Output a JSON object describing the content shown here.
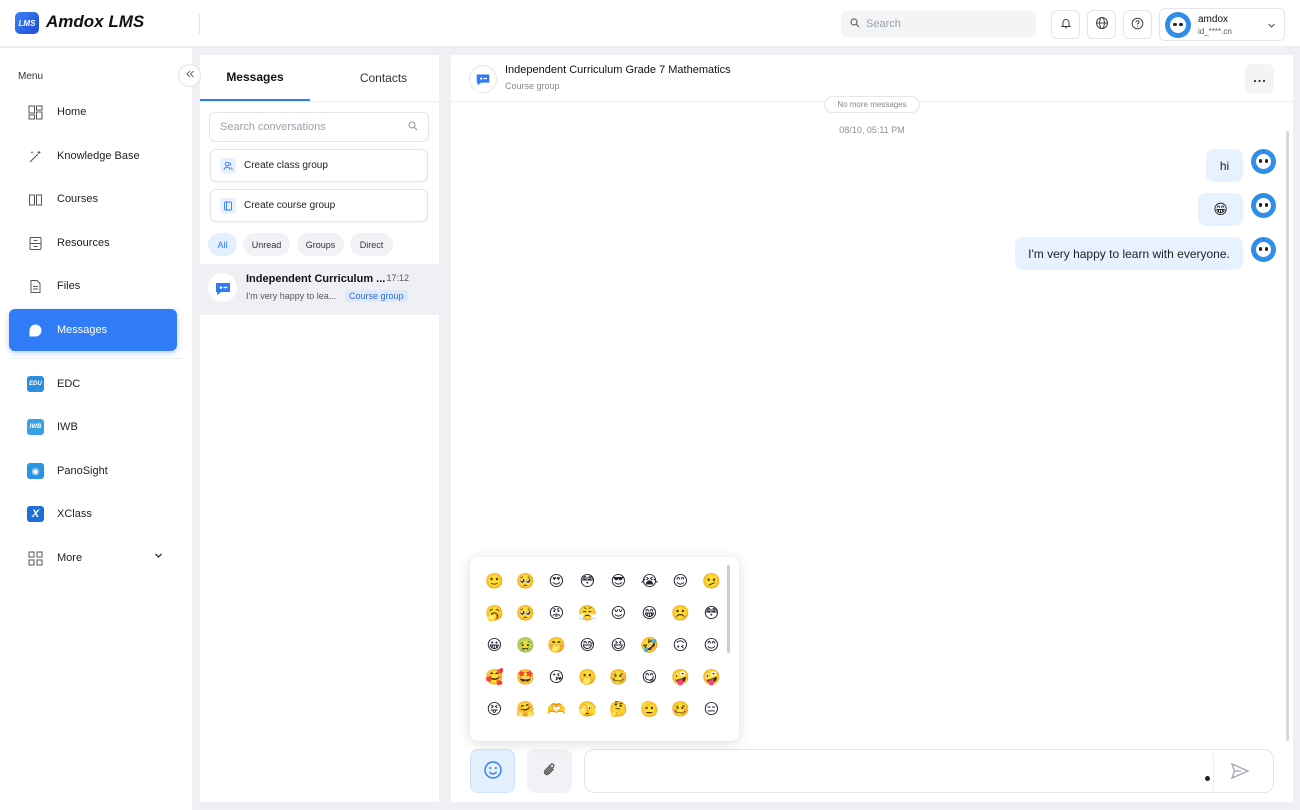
{
  "app": {
    "logo_text": "LMS",
    "title": "Amdox LMS"
  },
  "header": {
    "search_placeholder": "Search",
    "user": {
      "name": "amdox",
      "id": "id_****.cn"
    }
  },
  "sidebar": {
    "menu_label": "Menu",
    "items": [
      {
        "label": "Home",
        "icon": "home-icon"
      },
      {
        "label": "Knowledge Base",
        "icon": "wand-icon"
      },
      {
        "label": "Courses",
        "icon": "book-icon"
      },
      {
        "label": "Resources",
        "icon": "archive-icon"
      },
      {
        "label": "Files",
        "icon": "file-icon"
      },
      {
        "label": "Messages",
        "icon": "chat-icon",
        "active": true
      }
    ],
    "apps": [
      {
        "label": "EDC",
        "badge": "EDU",
        "color": "#2b8fe0"
      },
      {
        "label": "IWB",
        "badge": "IWB",
        "color": "#3aa0e6"
      },
      {
        "label": "PanoSight",
        "badge": "◉",
        "color": "#2596e8"
      },
      {
        "label": "XClass",
        "badge": "X",
        "color": "#1e6fd9"
      },
      {
        "label": "More",
        "icon": "grid-icon"
      }
    ]
  },
  "conversations": {
    "tabs": {
      "messages": "Messages",
      "contacts": "Contacts"
    },
    "search_placeholder": "Search conversations",
    "create_class_group": "Create class group",
    "create_course_group": "Create course group",
    "filters": [
      "All",
      "Unread",
      "Groups",
      "Direct"
    ],
    "items": [
      {
        "title": "Independent Curriculum ...",
        "time": "17:12",
        "preview": "I'm very happy to lea...",
        "tag": "Course group"
      }
    ]
  },
  "chat": {
    "title": "Independent Curriculum Grade 7 Mathematics",
    "subtitle": "Course group",
    "no_more": "No more messages",
    "timestamp": "08/10, 05:11 PM",
    "messages": [
      {
        "text": "hi"
      },
      {
        "text": "😁"
      },
      {
        "text": "I'm very happy to learn with everyone."
      }
    ]
  },
  "emoji_picker": {
    "emojis": [
      "🙂",
      "🥺",
      "😍",
      "😳",
      "😎",
      "😭",
      "😊",
      "🫤",
      "🥱",
      "🥺",
      "😡",
      "😤",
      "😌",
      "😁",
      "☹️",
      "😳",
      "😀",
      "🤢",
      "🤭",
      "😅",
      "😆",
      "🤣",
      "🙃",
      "😊",
      "🥰",
      "🤩",
      "😘",
      "🫢",
      "🥴",
      "😋",
      "🤪",
      "🤪",
      "😝",
      "🤗",
      "🫶",
      "🫣",
      "🤔",
      "🫡",
      "🥴",
      "😑"
    ]
  },
  "colors": {
    "accent": "#2f7cf6",
    "bubble": "#e7f1ff"
  }
}
